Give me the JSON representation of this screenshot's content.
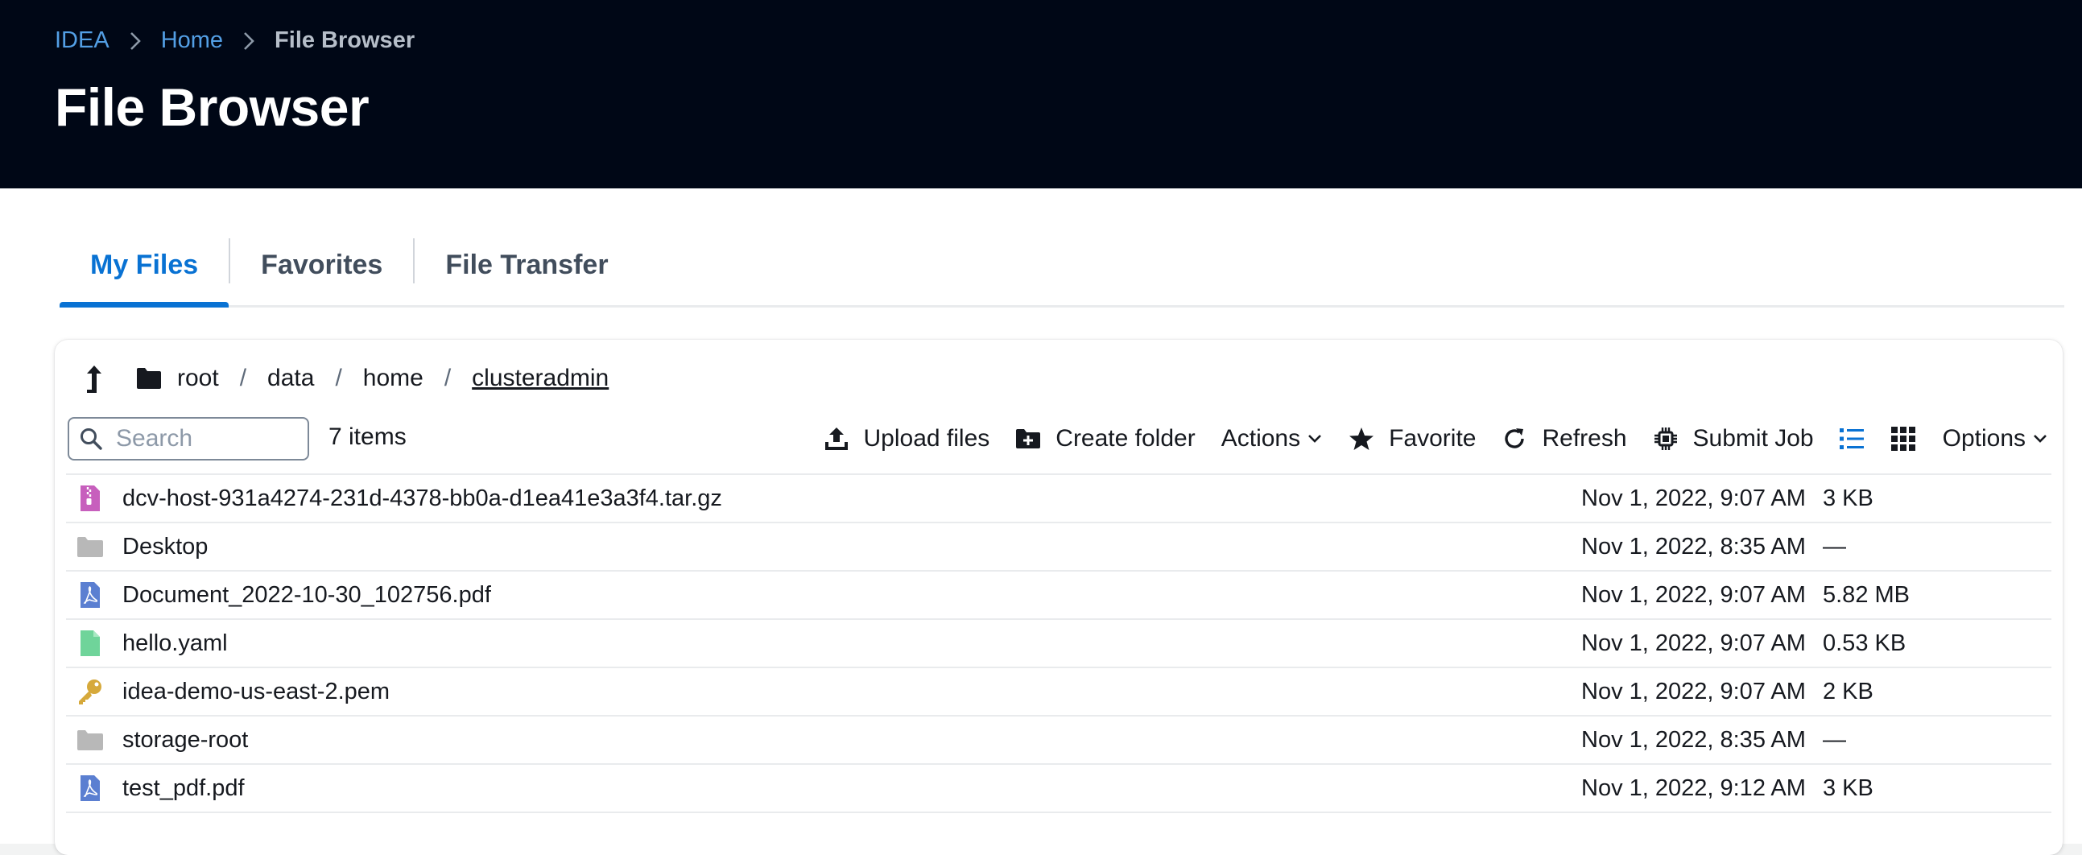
{
  "breadcrumb": {
    "items": [
      "IDEA",
      "Home"
    ],
    "current": "File Browser"
  },
  "page": {
    "title": "File Browser"
  },
  "tabs": [
    {
      "label": "My Files",
      "active": true
    },
    {
      "label": "Favorites",
      "active": false
    },
    {
      "label": "File Transfer",
      "active": false
    }
  ],
  "path": {
    "segments": [
      "root",
      "data",
      "home",
      "clusteradmin"
    ],
    "separator": "/"
  },
  "search": {
    "placeholder": "Search",
    "value": ""
  },
  "item_count": "7 items",
  "toolbar": {
    "upload": "Upload files",
    "create_folder": "Create folder",
    "actions": "Actions",
    "favorite": "Favorite",
    "refresh": "Refresh",
    "submit_job": "Submit Job",
    "options": "Options"
  },
  "files": [
    {
      "name": "dcv-host-931a4274-231d-4378-bb0a-d1ea41e3a3f4.tar.gz",
      "date": "Nov 1, 2022, 9:07 AM",
      "size": "3 KB",
      "icon": "archive-icon"
    },
    {
      "name": "Desktop",
      "date": "Nov 1, 2022, 8:35 AM",
      "size": "—",
      "icon": "folder-icon"
    },
    {
      "name": "Document_2022-10-30_102756.pdf",
      "date": "Nov 1, 2022, 9:07 AM",
      "size": "5.82 MB",
      "icon": "pdf-icon"
    },
    {
      "name": "hello.yaml",
      "date": "Nov 1, 2022, 9:07 AM",
      "size": "0.53 KB",
      "icon": "file-icon"
    },
    {
      "name": "idea-demo-us-east-2.pem",
      "date": "Nov 1, 2022, 9:07 AM",
      "size": "2 KB",
      "icon": "key-icon"
    },
    {
      "name": "storage-root",
      "date": "Nov 1, 2022, 8:35 AM",
      "size": "—",
      "icon": "folder-icon"
    },
    {
      "name": "test_pdf.pdf",
      "date": "Nov 1, 2022, 9:12 AM",
      "size": "3 KB",
      "icon": "pdf-icon"
    }
  ],
  "colors": {
    "header_bg": "#000716",
    "link": "#539fe5",
    "accent": "#0972d3",
    "archive": "#c75fbd",
    "folder": "#b8b8b8",
    "pdf": "#5b7fd1",
    "file": "#6fd49a",
    "key": "#d6a93b"
  }
}
